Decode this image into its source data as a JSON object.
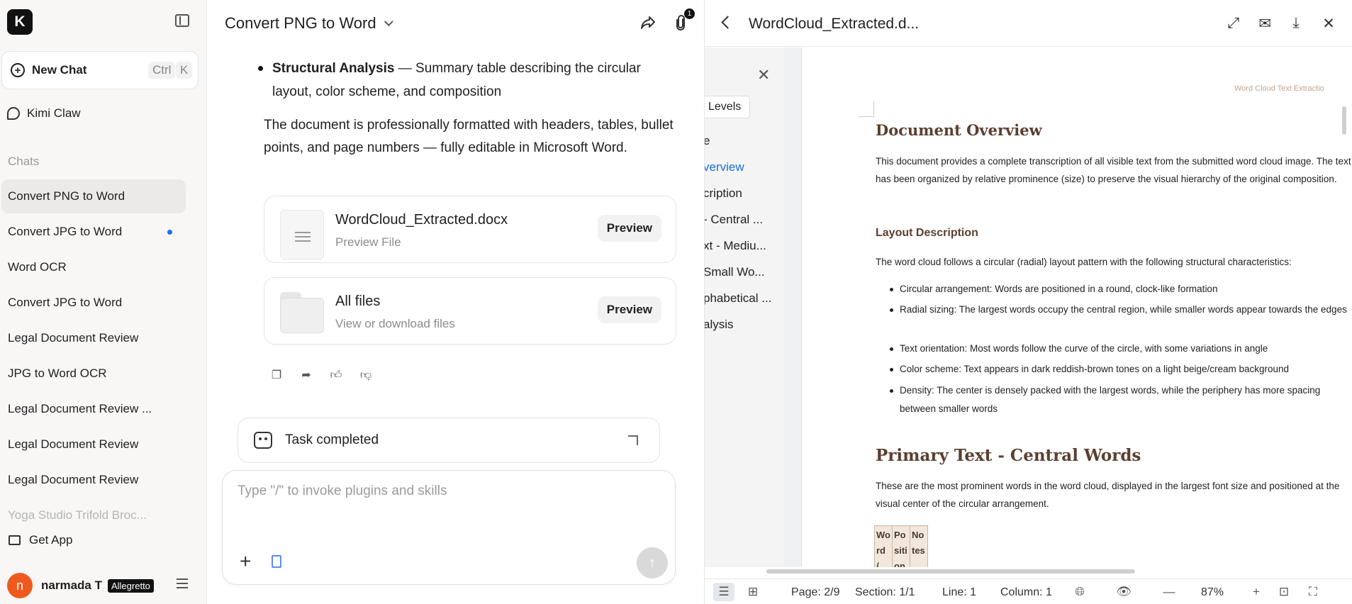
{
  "sidebar": {
    "logo_letter": "K",
    "new_chat_label": "New Chat",
    "shortcut_key1": "Ctrl",
    "shortcut_key2": "K",
    "kimi_claw_label": "Kimi Claw",
    "chats_section_label": "Chats",
    "chats": [
      {
        "label": "Convert PNG to Word",
        "active": true
      },
      {
        "label": "Convert JPG to Word",
        "unread": true
      },
      {
        "label": "Word OCR"
      },
      {
        "label": "Convert JPG to Word"
      },
      {
        "label": "Legal Document Review"
      },
      {
        "label": "JPG to Word OCR"
      },
      {
        "label": "Legal Document Review ..."
      },
      {
        "label": "Legal Document Review"
      },
      {
        "label": "Legal Document Review"
      },
      {
        "label": "Yoga Studio Trifold Broc..."
      }
    ],
    "get_app_label": "Get App",
    "user_initial": "n",
    "user_name": "narmada T",
    "user_plan": "Allegretto"
  },
  "chat": {
    "title": "Convert PNG to Word",
    "attachment_count": "1",
    "bullet_bold": "Structural Analysis",
    "bullet_text": " — Summary table describing the circular layout, color scheme, and composition",
    "paragraph": "The document is professionally formatted with headers, tables, bullet points, and page numbers — fully editable in Microsoft Word.",
    "file_card": {
      "name": "WordCloud_Extracted.docx",
      "sub": "Preview File",
      "button": "Preview"
    },
    "folder_card": {
      "name": "All files",
      "sub": "View or download files",
      "button": "Preview"
    },
    "task_status": "Task completed",
    "composer_placeholder": "Type \"/\" to invoke plugins and skills"
  },
  "preview": {
    "title": "WordCloud_Extracted.d...",
    "toc": {
      "levels_button": "Levels",
      "items": [
        {
          "label": "e"
        },
        {
          "label": "verview",
          "active": true
        },
        {
          "label": "cription"
        },
        {
          "label": "- Central ..."
        },
        {
          "label": "xt - Mediu..."
        },
        {
          "label": "Small Wo..."
        },
        {
          "label": "phabetical ..."
        },
        {
          "label": "alysis"
        }
      ]
    },
    "doc": {
      "running_header": "Word Cloud Text Extractio",
      "h1_overview": "Document Overview",
      "p_overview": "This document provides a complete transcription of all visible text from the submitted word cloud image. The text has been organized by relative prominence (size) to preserve the visual hierarchy of the original composition.",
      "h2_layout": "Layout Description",
      "p_layout": "The word cloud follows a circular (radial) layout pattern with the following structural characteristics:",
      "bullets": [
        "Circular arrangement: Words are positioned in a round, clock-like formation",
        "Radial sizing: The largest words occupy the central region, while smaller words appear towards the edges",
        "Text orientation: Most words follow the curve of the circle, with some variations in angle",
        "Color scheme: Text appears in dark reddish-brown tones on a light beige/cream background",
        "Density: The center is densely packed with the largest words, while the periphery has more spacing between smaller words"
      ],
      "h1_primary": "Primary Text - Central Words",
      "p_primary": "These are the most prominent words in the word cloud, displayed in the largest font size and positioned at the visual center of the circular arrangement.",
      "table_headers": [
        "Word / ",
        "Position",
        "Notes"
      ]
    },
    "status": {
      "page": "Page: 2/9",
      "section": "Section: 1/1",
      "line": "Line: 1",
      "column": "Column: 1",
      "zoom": "87%"
    }
  },
  "colors": {
    "accent_blue": "#1a73e8",
    "avatar_orange": "#ee5a1d",
    "doc_heading_brown": "#5b3f30",
    "table_header_bg": "#f1e7dc"
  }
}
